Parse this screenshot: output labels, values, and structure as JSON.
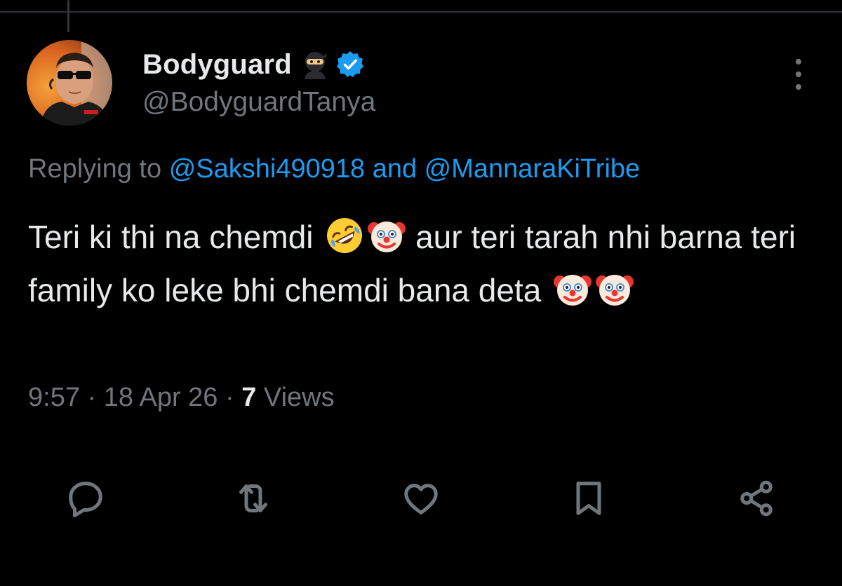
{
  "tweet": {
    "author": {
      "display_name": "Bodyguard",
      "handle": "@BodyguardTanya",
      "name_emoji": "ninja",
      "verified": true
    },
    "reply": {
      "prefix": "Replying to",
      "mention_1": "@Sakshi490918",
      "joiner": "and",
      "mention_2": "@MannaraKiTribe"
    },
    "text": {
      "part_1": "Teri ki thi na chemdi",
      "part_2": "aur teri tarah nhi barna teri family ko leke bhi chemdi bana deta",
      "emojis_1": [
        "rolling-on-floor-laughing",
        "clown-face"
      ],
      "emojis_2": [
        "clown-face",
        "clown-face"
      ]
    },
    "meta": {
      "time": "9:57",
      "separator": "·",
      "date": "18 Apr 26",
      "views_count": "7",
      "views_label": "Views"
    }
  },
  "actions": [
    "reply-icon",
    "retweet-icon",
    "like-icon",
    "bookmark-icon",
    "share-icon"
  ],
  "colors": {
    "background": "#000000",
    "text": "#e7e9ea",
    "secondary": "#71767b",
    "accent": "#1d9bf0"
  }
}
